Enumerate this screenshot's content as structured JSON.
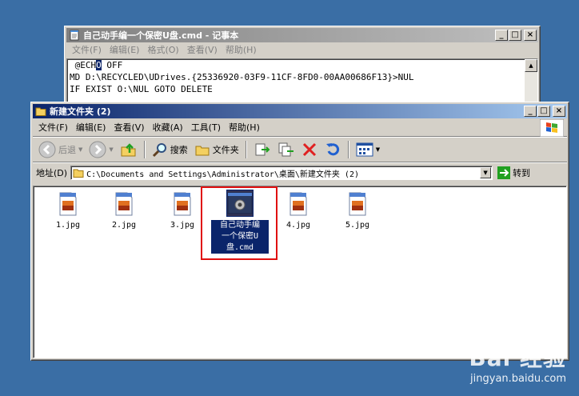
{
  "notepad": {
    "title": "自己动手编一个保密U盘.cmd - 记事本",
    "menu": [
      "文件(F)",
      "编辑(E)",
      "格式(O)",
      "查看(V)",
      "帮助(H)"
    ],
    "lines": [
      {
        "pre": " @ECH",
        "sel": "O",
        "post": " OFF"
      },
      {
        "pre": "MD D:\\RECYCLED\\UDrives.{25336920-03F9-11CF-8FD0-00AA00686F13}>NUL",
        "sel": "",
        "post": ""
      },
      {
        "pre": "IF EXIST O:\\NUL GOTO DELETE",
        "sel": "",
        "post": ""
      }
    ]
  },
  "explorer": {
    "title": "新建文件夹 (2)",
    "menu": [
      "文件(F)",
      "编辑(E)",
      "查看(V)",
      "收藏(A)",
      "工具(T)",
      "帮助(H)"
    ],
    "toolbar": {
      "back": "后退",
      "search": "搜索",
      "folders": "文件夹"
    },
    "address": {
      "label": "地址(D)",
      "path": "C:\\Documents and Settings\\Administrator\\桌面\\新建文件夹 (2)",
      "go": "转到"
    },
    "files": [
      {
        "name": "1.jpg"
      },
      {
        "name": "2.jpg"
      },
      {
        "name": "3.jpg"
      },
      {
        "name": "自己动手编一个保密U盘.cmd",
        "lines": [
          "自己动手编",
          "一个保密U",
          "盘.cmd"
        ],
        "selected": true
      },
      {
        "name": "4.jpg"
      },
      {
        "name": "5.jpg"
      }
    ]
  },
  "window_buttons": {
    "minimize": "_",
    "maximize": "□",
    "close": "×"
  },
  "watermark": {
    "top": "Bai 经验",
    "bottom": "jingyan.baidu.com"
  },
  "colors": {
    "desktop": "#3a6ea5",
    "active_title": "#0a246a",
    "highlight_box": "#e01010"
  }
}
